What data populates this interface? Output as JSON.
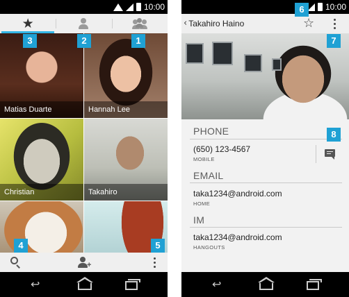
{
  "status_bar": {
    "time": "10:00"
  },
  "left_screen": {
    "tabs": [
      {
        "name": "favorites",
        "icon": "star-icon",
        "active": true
      },
      {
        "name": "contacts",
        "icon": "person-icon",
        "active": false
      },
      {
        "name": "groups",
        "icon": "group-icon",
        "active": false
      }
    ],
    "contacts": [
      {
        "name": "Matias Duarte"
      },
      {
        "name": "Hannah Lee"
      },
      {
        "name": "Christian"
      },
      {
        "name": "Takahiro"
      },
      {
        "name": ""
      },
      {
        "name": ""
      }
    ],
    "bottom_actions": [
      "search-icon",
      "add-contact-icon",
      "overflow-menu-icon"
    ]
  },
  "right_screen": {
    "title": "Takahiro Haino",
    "sections": {
      "phone": {
        "header": "PHONE",
        "value": "(650) 123-4567",
        "type": "MOBILE"
      },
      "email": {
        "header": "EMAIL",
        "value": "taka1234@android.com",
        "type": "HOME"
      },
      "im": {
        "header": "IM",
        "value": "taka1234@android.com",
        "type": "HANGOUTS"
      }
    }
  },
  "callouts": {
    "b1": "1",
    "b2": "2",
    "b3": "3",
    "b4": "4",
    "b5": "5",
    "b6": "6",
    "b7": "7",
    "b8": "8"
  },
  "colors": {
    "callout": "#1fa1d4",
    "tab_indicator": "#33b5e5",
    "bar_bg": "#efefef"
  }
}
